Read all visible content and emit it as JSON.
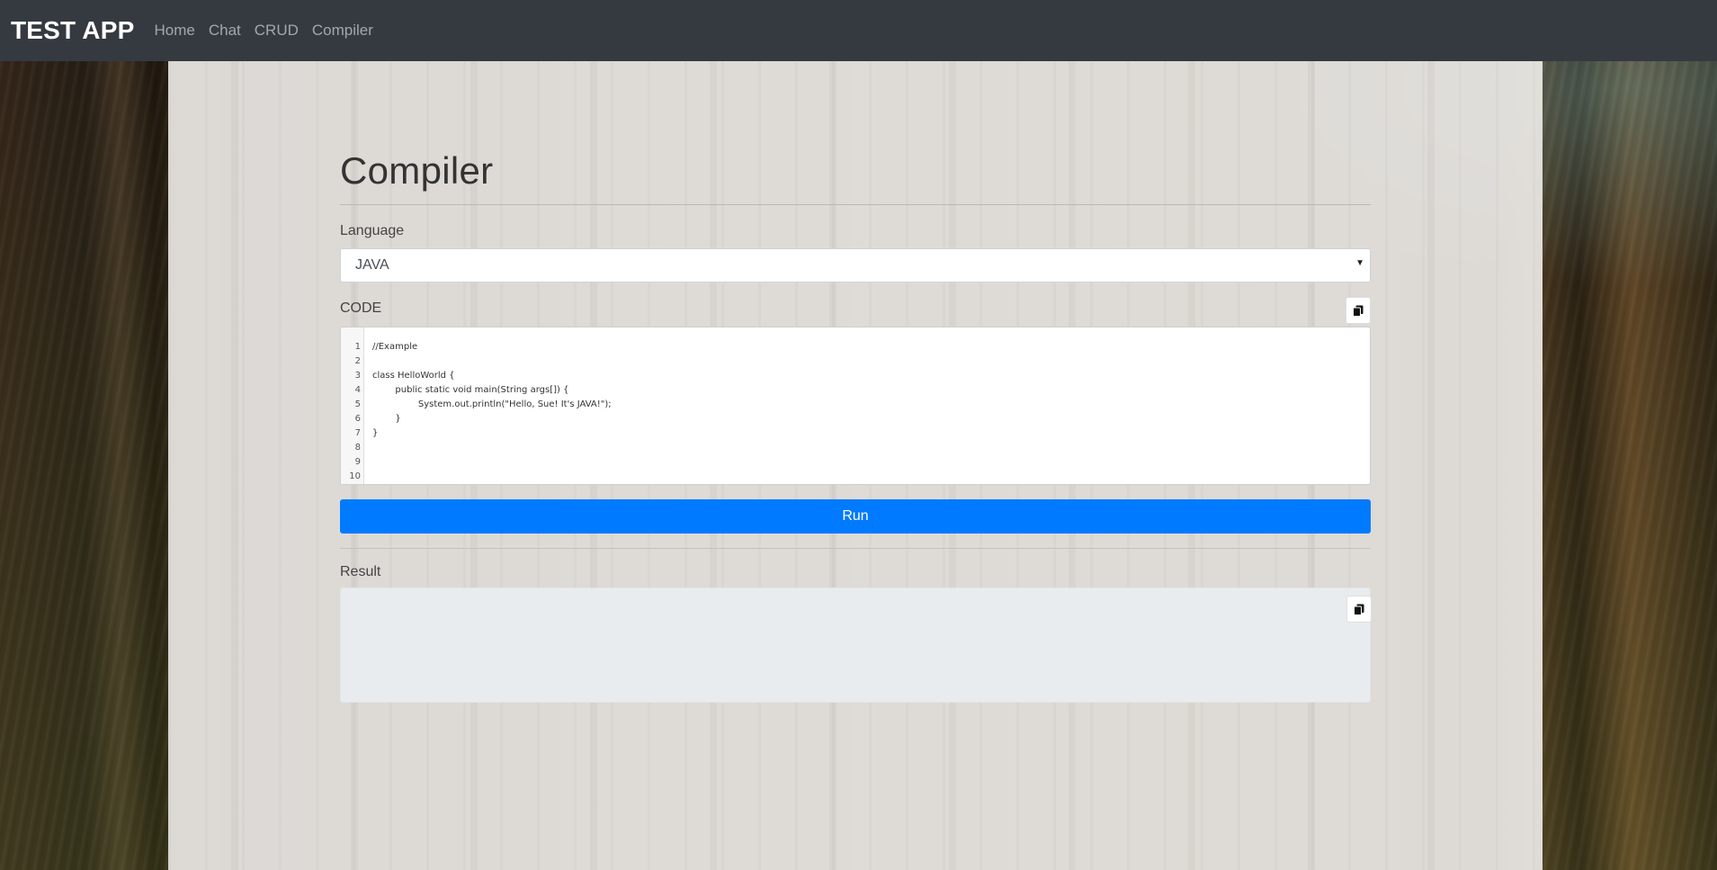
{
  "navbar": {
    "brand": "TEST APP",
    "links": [
      "Home",
      "Chat",
      "CRUD",
      "Compiler"
    ]
  },
  "page": {
    "title": "Compiler"
  },
  "language": {
    "label": "Language",
    "selected": "JAVA"
  },
  "code": {
    "label": "CODE",
    "line_numbers": [
      "1",
      "2",
      "3",
      "4",
      "5",
      "6",
      "7",
      "8",
      "9",
      "10"
    ],
    "lines": [
      "//Example",
      "",
      "class HelloWorld {",
      "        public static void main(String args[]) {",
      "                System.out.println(\"Hello, Sue! It's JAVA!\");",
      "        }",
      "}",
      "",
      "",
      ""
    ]
  },
  "run": {
    "label": "Run"
  },
  "result": {
    "label": "Result",
    "output": ""
  },
  "icons": {
    "copy": "copy-icon",
    "select_caret": "caret-down-icon"
  },
  "colors": {
    "navbar": "#343a40",
    "primary": "#007bff",
    "result_bg": "#e9ecef"
  }
}
